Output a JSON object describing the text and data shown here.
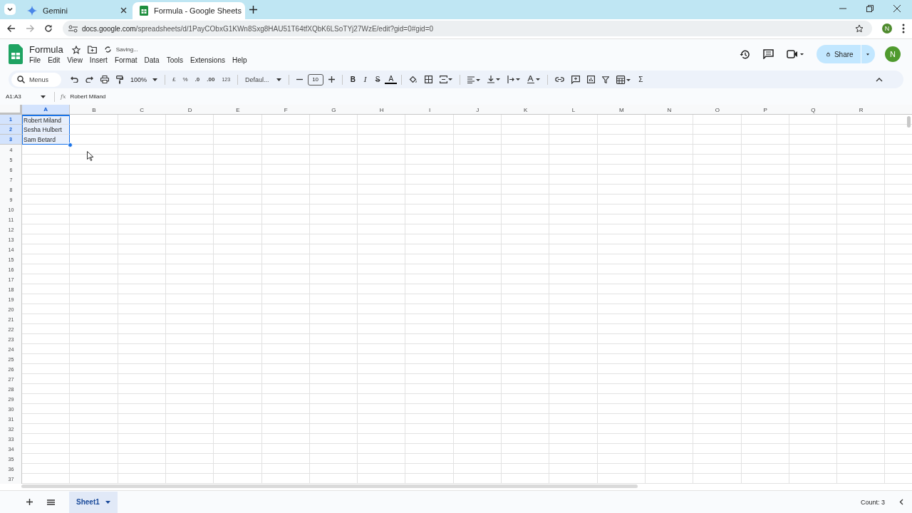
{
  "browser": {
    "tabs": [
      {
        "title": "Gemini",
        "kind": "gemini",
        "selected": false
      },
      {
        "title": "Formula - Google Sheets",
        "kind": "sheets",
        "selected": true
      }
    ],
    "profile_avatar": "N",
    "url_host": "docs.google.com",
    "url_path": "/spreadsheets/d/1PayCObxG1KWn8Sxg8HAU51T64tfXQbK6LSoTYj27WzE/edit?gid=0#gid=0"
  },
  "doc": {
    "title": "Formula",
    "status": "Saving...",
    "menus": [
      "File",
      "Edit",
      "View",
      "Insert",
      "Format",
      "Data",
      "Tools",
      "Extensions",
      "Help"
    ],
    "share": "Share",
    "avatar": "N"
  },
  "toolbar": {
    "search": "Menus",
    "zoom": "100%",
    "currency": "£",
    "percent": "%",
    "decrease_decimals": ".0",
    "increase_decimals": ".00",
    "number_format": "123",
    "font": "Defaul...",
    "font_size": "10",
    "text_buttons": [
      {
        "label": "B",
        "kind": "bold"
      },
      {
        "label": "I",
        "kind": "italic"
      },
      {
        "label": "S",
        "kind": "strike"
      },
      {
        "label": "A",
        "kind": "color"
      }
    ],
    "functions": "Σ"
  },
  "formula_bar": {
    "name_box": "A1:A3",
    "fx": "fx",
    "content": "Robert Miland"
  },
  "grid": {
    "columns": [
      {
        "label": "A",
        "selected": true
      },
      {
        "label": "B",
        "selected": false
      },
      {
        "label": "C",
        "selected": false
      },
      {
        "label": "D",
        "selected": false
      },
      {
        "label": "E",
        "selected": false
      },
      {
        "label": "F",
        "selected": false
      },
      {
        "label": "G",
        "selected": false
      },
      {
        "label": "H",
        "selected": false
      },
      {
        "label": "I",
        "selected": false
      },
      {
        "label": "J",
        "selected": false
      },
      {
        "label": "K",
        "selected": false
      },
      {
        "label": "L",
        "selected": false
      },
      {
        "label": "M",
        "selected": false
      },
      {
        "label": "N",
        "selected": false
      },
      {
        "label": "O",
        "selected": false
      },
      {
        "label": "P",
        "selected": false
      },
      {
        "label": "Q",
        "selected": false
      },
      {
        "label": "R",
        "selected": false
      }
    ],
    "rows": [
      {
        "label": "1",
        "selected": true,
        "cells": [
          "Robert Miland"
        ]
      },
      {
        "label": "2",
        "selected": true,
        "cells": [
          "Sesha Hulbert"
        ]
      },
      {
        "label": "3",
        "selected": true,
        "cells": [
          "Sam Betard"
        ]
      },
      {
        "label": "4",
        "selected": false
      },
      {
        "label": "5",
        "selected": false
      },
      {
        "label": "6",
        "selected": false
      },
      {
        "label": "7",
        "selected": false
      },
      {
        "label": "8",
        "selected": false
      },
      {
        "label": "9",
        "selected": false
      },
      {
        "label": "10",
        "selected": false
      },
      {
        "label": "11",
        "selected": false
      },
      {
        "label": "12",
        "selected": false
      },
      {
        "label": "13",
        "selected": false
      },
      {
        "label": "14",
        "selected": false
      },
      {
        "label": "15",
        "selected": false
      },
      {
        "label": "16",
        "selected": false
      },
      {
        "label": "17",
        "selected": false
      },
      {
        "label": "18",
        "selected": false
      },
      {
        "label": "19",
        "selected": false
      },
      {
        "label": "20",
        "selected": false
      },
      {
        "label": "21",
        "selected": false
      },
      {
        "label": "22",
        "selected": false
      },
      {
        "label": "23",
        "selected": false
      },
      {
        "label": "24",
        "selected": false
      },
      {
        "label": "25",
        "selected": false
      },
      {
        "label": "26",
        "selected": false
      },
      {
        "label": "27",
        "selected": false
      },
      {
        "label": "28",
        "selected": false
      },
      {
        "label": "29",
        "selected": false
      },
      {
        "label": "30",
        "selected": false
      },
      {
        "label": "31",
        "selected": false
      },
      {
        "label": "32",
        "selected": false
      },
      {
        "label": "33",
        "selected": false
      },
      {
        "label": "34",
        "selected": false
      },
      {
        "label": "35",
        "selected": false
      },
      {
        "label": "36",
        "selected": false
      },
      {
        "label": "37",
        "selected": false
      }
    ]
  },
  "sheets": [
    {
      "label": "Sheet1",
      "selected": true
    }
  ],
  "status": "Count: 3"
}
